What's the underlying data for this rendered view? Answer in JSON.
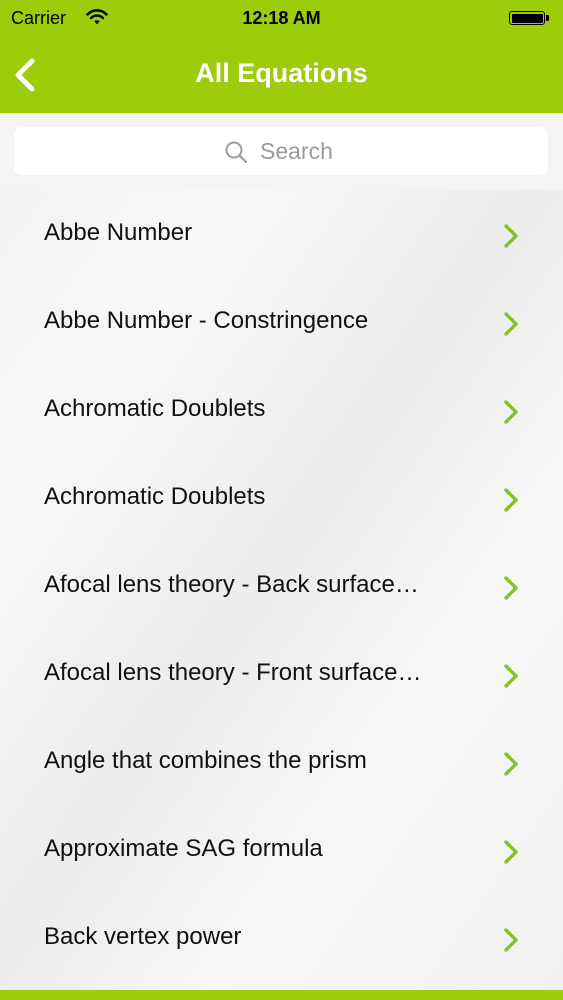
{
  "status_bar": {
    "carrier": "Carrier",
    "time": "12:18 AM"
  },
  "nav": {
    "title": "All Equations",
    "back_icon": "chevron-left-icon"
  },
  "search": {
    "placeholder": "Search",
    "icon": "search-icon"
  },
  "equations": [
    "Abbe Number",
    "Abbe Number - Constringence",
    "Achromatic Doublets",
    "Achromatic Doublets",
    "Afocal lens theory - Back surface…",
    "Afocal lens theory - Front surface…",
    "Angle that combines the prism",
    "Approximate SAG formula",
    "Back vertex power"
  ],
  "colors": {
    "accent": "#9ccc0a",
    "chevron": "#8cbf26"
  }
}
